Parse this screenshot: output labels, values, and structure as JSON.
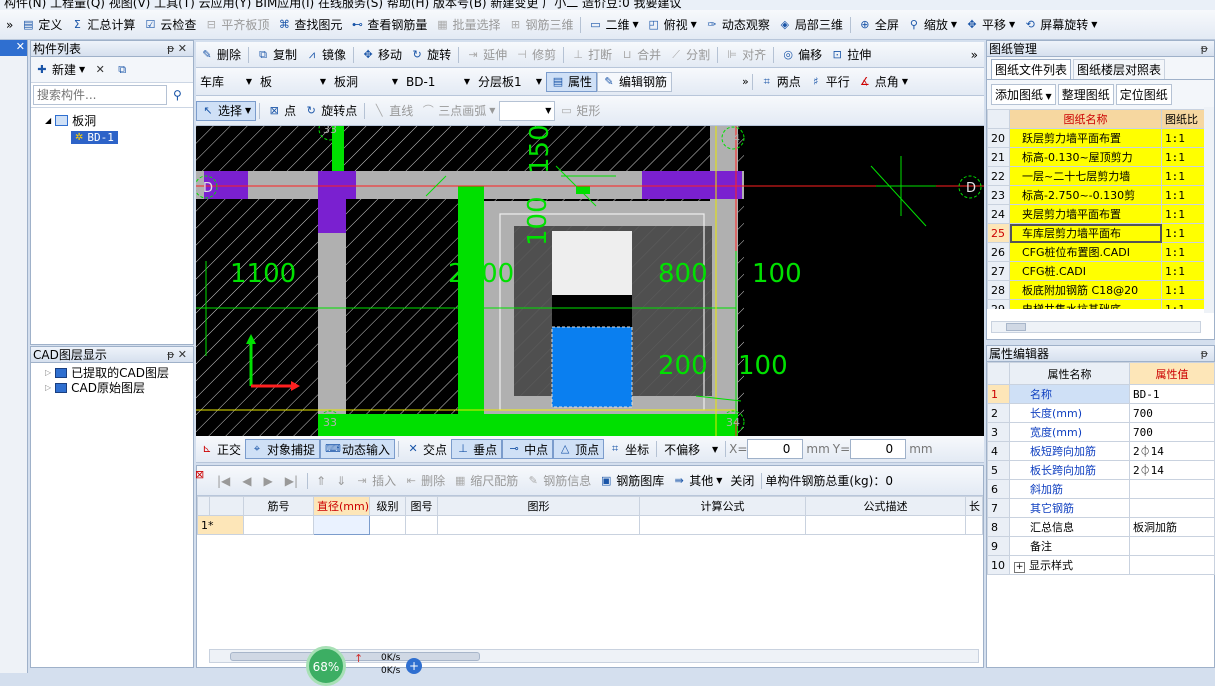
{
  "menubar": {
    "text": "构件(N)  工程量(Q)  视图(V)  工具(T)  云应用(Y)  BIM应用(I)  在线服务(S)  帮助(H)  版本号(B)  新建变更  广小二       造价豆:0  我要建议"
  },
  "toolbar1": {
    "items": [
      {
        "label": "定义",
        "icon": "define-icon"
      },
      {
        "label": "汇总计算",
        "icon": "sigma-icon"
      },
      {
        "label": "云检查",
        "icon": "cloud-check-icon"
      },
      {
        "label": "平齐板顶",
        "icon": "align-slab-icon",
        "disabled": true
      },
      {
        "label": "查找图元",
        "icon": "binoculars-icon"
      },
      {
        "label": "查看钢筋量",
        "icon": "rebar-view-icon"
      },
      {
        "label": "批量选择",
        "icon": "batch-select-icon",
        "disabled": true
      },
      {
        "label": "钢筋三维",
        "icon": "rebar-3d-icon",
        "disabled": true
      },
      {
        "label": "二维",
        "icon": "2d-icon",
        "dropdown": true
      },
      {
        "label": "俯视",
        "icon": "top-view-icon",
        "dropdown": true
      },
      {
        "label": "动态观察",
        "icon": "orbit-icon"
      },
      {
        "label": "局部三维",
        "icon": "local-3d-icon"
      },
      {
        "label": "全屏",
        "icon": "fullscreen-icon"
      },
      {
        "label": "缩放",
        "icon": "zoom-icon",
        "dropdown": true
      },
      {
        "label": "平移",
        "icon": "pan-icon",
        "dropdown": true
      },
      {
        "label": "屏幕旋转",
        "icon": "screen-rotate-icon",
        "dropdown": true
      }
    ]
  },
  "component_list": {
    "title": "构件列表",
    "new_label": "新建",
    "search_placeholder": "搜索构件...",
    "tree_root": "板洞",
    "tree_child": "BD-1"
  },
  "cad_layers": {
    "title": "CAD图层显示",
    "items": [
      "已提取的CAD图层",
      "CAD原始图层"
    ]
  },
  "edit_toolbar": {
    "items": [
      {
        "label": "删除",
        "icon": "delete-icon"
      },
      {
        "label": "复制",
        "icon": "copy-icon"
      },
      {
        "label": "镜像",
        "icon": "mirror-icon"
      },
      {
        "label": "移动",
        "icon": "move-icon"
      },
      {
        "label": "旋转",
        "icon": "rotate-icon"
      },
      {
        "label": "延伸",
        "icon": "extend-icon",
        "disabled": true
      },
      {
        "label": "修剪",
        "icon": "trim-icon",
        "disabled": true
      },
      {
        "label": "打断",
        "icon": "break-icon",
        "disabled": true
      },
      {
        "label": "合并",
        "icon": "merge-icon",
        "disabled": true
      },
      {
        "label": "分割",
        "icon": "split-icon",
        "disabled": true
      },
      {
        "label": "对齐",
        "icon": "align-icon",
        "disabled": true
      },
      {
        "label": "偏移",
        "icon": "offset-icon"
      },
      {
        "label": "拉伸",
        "icon": "stretch-icon"
      }
    ]
  },
  "selectors": {
    "floor": "车库",
    "type": "板",
    "subtype": "板洞",
    "component": "BD-1",
    "layer": "分层板1",
    "attr_label": "属性",
    "edit_rebar_label": "编辑钢筋",
    "two_point": "两点",
    "parallel": "平行",
    "point_angle": "点角"
  },
  "draw_toolbar": {
    "select": "选择",
    "point": "点",
    "rotate_point": "旋转点",
    "line": "直线",
    "arc": "三点画弧",
    "rect": "矩形"
  },
  "canvas": {
    "dims": [
      "1100",
      "2800",
      "800",
      "100",
      "200",
      "100",
      "150",
      "100"
    ],
    "axis_labels": [
      "D",
      "D",
      "34",
      "34",
      "33",
      "33"
    ],
    "colors": {
      "bg": "#000000",
      "green": "#00e000",
      "purple": "#7a20d0",
      "gray": "#b0b0b0",
      "blue": "#0a7ff0",
      "white": "#eeeeee",
      "red": "#ff2020",
      "yellow": "#e8e800"
    }
  },
  "snap_toolbar": {
    "ortho": "正交",
    "snap": "对象捕捉",
    "dynamic_input": "动态输入",
    "intersection": "交点",
    "perpendicular": "垂点",
    "midpoint": "中点",
    "vertex": "顶点",
    "coordinate": "坐标",
    "offset_mode": "不偏移",
    "x_label": "X=",
    "x_value": "0",
    "y_label": "Y=",
    "y_value": "0",
    "unit": "mm"
  },
  "rebar_toolbar": {
    "insert": "插入",
    "delete": "删除",
    "scale_rebar": "缩尺配筋",
    "rebar_info": "钢筋信息",
    "rebar_library": "钢筋图库",
    "other": "其他",
    "close": "关闭",
    "total_weight": "单构件钢筋总重(kg)：0"
  },
  "rebar_table": {
    "headers": [
      "筋号",
      "直径(mm)",
      "级别",
      "图号",
      "图形",
      "计算公式",
      "公式描述",
      "长"
    ],
    "row_label": "1*"
  },
  "status": {
    "progress": "68%",
    "speed_up": "0K/s",
    "speed_down": "0K/s"
  },
  "drawing_manager": {
    "title": "图纸管理",
    "tabs": [
      "图纸文件列表",
      "图纸楼层对照表"
    ],
    "buttons": [
      "添加图纸",
      "整理图纸",
      "定位图纸"
    ],
    "headers": [
      "图纸名称",
      "图纸比"
    ],
    "rows": [
      {
        "no": "20",
        "name": "跃层剪力墙平面布置",
        "ratio": "1:1"
      },
      {
        "no": "21",
        "name": "标高-0.130~屋顶剪力",
        "ratio": "1:1"
      },
      {
        "no": "22",
        "name": "一层~二十七层剪力墙",
        "ratio": "1:1"
      },
      {
        "no": "23",
        "name": "标高-2.750~-0.130剪",
        "ratio": "1:1"
      },
      {
        "no": "24",
        "name": "夹层剪力墙平面布置",
        "ratio": "1:1"
      },
      {
        "no": "25",
        "name": "车库层剪力墙平面布",
        "ratio": "1:1",
        "selected": true
      },
      {
        "no": "26",
        "name": "CFG桩位布置图.CADI",
        "ratio": "1:1"
      },
      {
        "no": "27",
        "name": "CFG桩.CADI",
        "ratio": "1:1"
      },
      {
        "no": "28",
        "name": "板底附加钢筋 C18@20",
        "ratio": "1:1"
      },
      {
        "no": "29",
        "name": "电梯井集水坑基础底",
        "ratio": "1:1"
      }
    ]
  },
  "property_editor": {
    "title": "属性编辑器",
    "headers": [
      "属性名称",
      "属性值"
    ],
    "rows": [
      {
        "no": "1",
        "name": "名称",
        "value": "BD-1",
        "blue": true
      },
      {
        "no": "2",
        "name": "长度(mm)",
        "value": "700",
        "blue": true
      },
      {
        "no": "3",
        "name": "宽度(mm)",
        "value": "700",
        "blue": true
      },
      {
        "no": "4",
        "name": "板短跨向加筋",
        "value": "2⏀14",
        "blue": true
      },
      {
        "no": "5",
        "name": "板长跨向加筋",
        "value": "2⏀14",
        "blue": true
      },
      {
        "no": "6",
        "name": "斜加筋",
        "value": "",
        "blue": true
      },
      {
        "no": "7",
        "name": "其它钢筋",
        "value": "",
        "blue": true
      },
      {
        "no": "8",
        "name": "汇总信息",
        "value": "板洞加筋",
        "blue": false
      },
      {
        "no": "9",
        "name": "备注",
        "value": "",
        "blue": false
      },
      {
        "no": "10",
        "name": "显示样式",
        "value": "",
        "blue": false,
        "expand": true
      }
    ]
  }
}
